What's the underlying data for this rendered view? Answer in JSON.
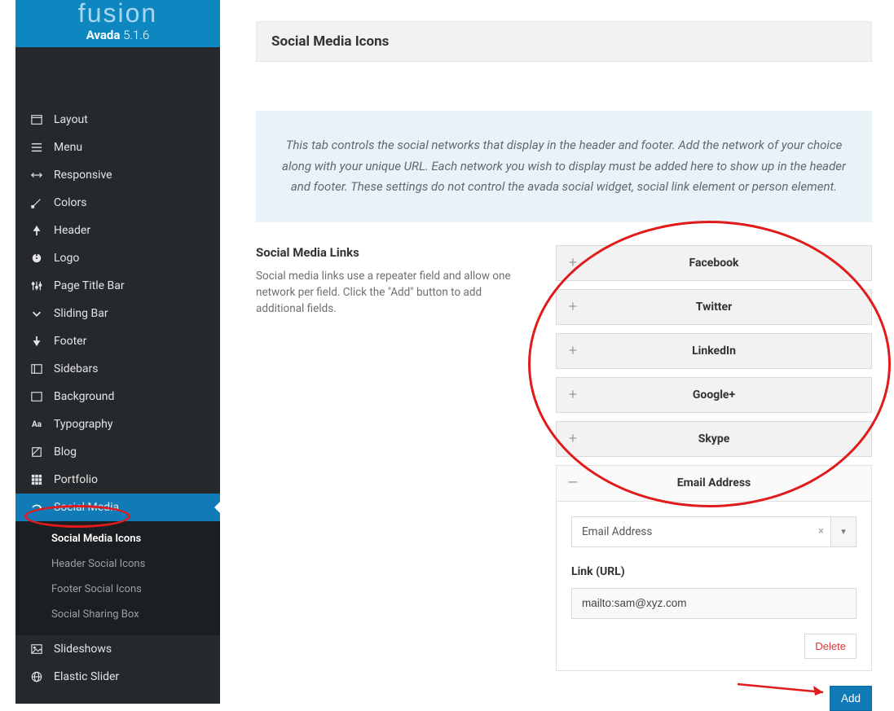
{
  "brand": {
    "logo": "fusion",
    "name": "Avada",
    "version": "5.1.6"
  },
  "sidebar": {
    "items": [
      {
        "label": "Layout"
      },
      {
        "label": "Menu"
      },
      {
        "label": "Responsive"
      },
      {
        "label": "Colors"
      },
      {
        "label": "Header"
      },
      {
        "label": "Logo"
      },
      {
        "label": "Page Title Bar"
      },
      {
        "label": "Sliding Bar"
      },
      {
        "label": "Footer"
      },
      {
        "label": "Sidebars"
      },
      {
        "label": "Background"
      },
      {
        "label": "Typography"
      },
      {
        "label": "Blog"
      },
      {
        "label": "Portfolio"
      },
      {
        "label": "Social Media"
      },
      {
        "label": "Slideshows"
      },
      {
        "label": "Elastic Slider"
      }
    ],
    "sub": [
      {
        "label": "Social Media Icons"
      },
      {
        "label": "Header Social Icons"
      },
      {
        "label": "Footer Social Icons"
      },
      {
        "label": "Social Sharing Box"
      }
    ]
  },
  "section": {
    "title": "Social Media Icons"
  },
  "info": "This tab controls the social networks that display in the header and footer. Add the network of your choice along with your unique URL. Each network you wish to display must be added here to show up in the header and footer. These settings do not control the avada social widget, social link element or person element.",
  "links": {
    "heading": "Social Media Links",
    "description": "Social media links use a repeater field and allow one network per field. Click the \"Add\" button to add additional fields.",
    "items": [
      {
        "label": "Facebook"
      },
      {
        "label": "Twitter"
      },
      {
        "label": "LinkedIn"
      },
      {
        "label": "Google+"
      },
      {
        "label": "Skype"
      }
    ],
    "expanded": {
      "label": "Email Address",
      "select_value": "Email Address",
      "url_label": "Link (URL)",
      "url_value": "mailto:sam@xyz.com",
      "delete": "Delete"
    },
    "add": "Add"
  }
}
